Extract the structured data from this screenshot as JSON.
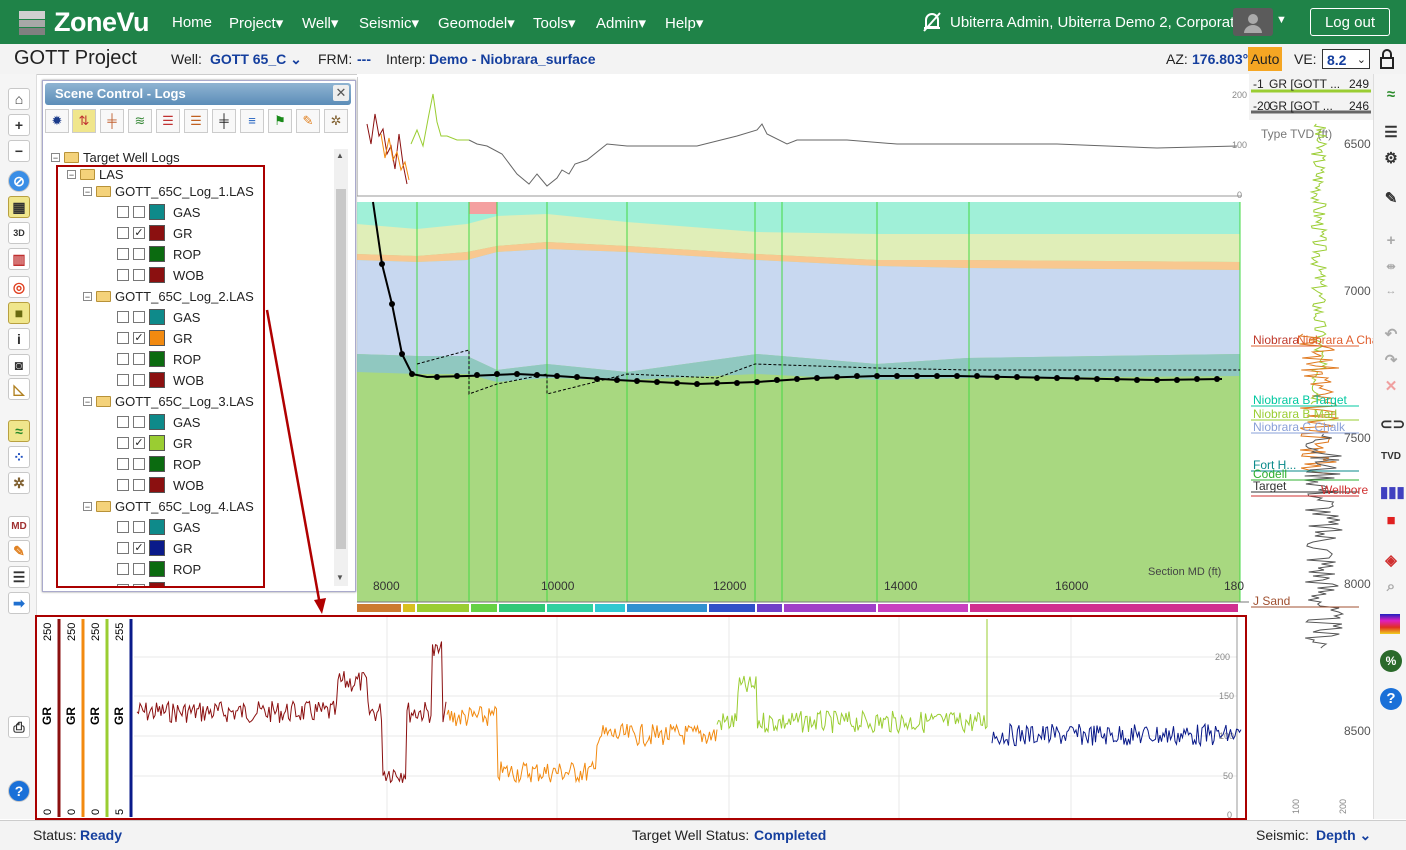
{
  "app": {
    "name": "ZoneVu"
  },
  "nav": {
    "menus": [
      "Home",
      "Project",
      "Well",
      "Seismic",
      "Geomodel",
      "Tools",
      "Admin",
      "Help"
    ],
    "user": "Ubiterra Admin, Ubiterra Demo 2, Corporate",
    "logout": "Log out"
  },
  "project": {
    "title": "GOTT Project",
    "well_label": "Well:",
    "well_value": "GOTT 65_C",
    "frm_label": "FRM:",
    "frm_value": "---",
    "interp_label": "Interp:",
    "interp_value": "Demo - Niobrara_surface",
    "az_label": "AZ:",
    "az_value": "176.803°",
    "auto_label": "Auto",
    "ve_label": "VE:",
    "ve_value": "8.2"
  },
  "scene": {
    "title": "Scene Control - Logs",
    "root": "Target Well Logs",
    "group": "LAS",
    "files": [
      {
        "name": "GOTT_65C_Log_1.LAS",
        "curves": [
          {
            "name": "GAS",
            "color": "#0e8a8a",
            "checked": false
          },
          {
            "name": "GR",
            "color": "#8b1010",
            "checked": true
          },
          {
            "name": "ROP",
            "color": "#0b6b10",
            "checked": false
          },
          {
            "name": "WOB",
            "color": "#8b1010",
            "checked": false
          }
        ]
      },
      {
        "name": "GOTT_65C_Log_2.LAS",
        "curves": [
          {
            "name": "GAS",
            "color": "#0e8a8a",
            "checked": false
          },
          {
            "name": "GR",
            "color": "#f28a10",
            "checked": true
          },
          {
            "name": "ROP",
            "color": "#0b6b10",
            "checked": false
          },
          {
            "name": "WOB",
            "color": "#8b1010",
            "checked": false
          }
        ]
      },
      {
        "name": "GOTT_65C_Log_3.LAS",
        "curves": [
          {
            "name": "GAS",
            "color": "#0e8a8a",
            "checked": false
          },
          {
            "name": "GR",
            "color": "#9acd32",
            "checked": true
          },
          {
            "name": "ROP",
            "color": "#0b6b10",
            "checked": false
          },
          {
            "name": "WOB",
            "color": "#8b1010",
            "checked": false
          }
        ]
      },
      {
        "name": "GOTT_65C_Log_4.LAS",
        "curves": [
          {
            "name": "GAS",
            "color": "#0e8a8a",
            "checked": false
          },
          {
            "name": "GR",
            "color": "#0a1a8a",
            "checked": true
          },
          {
            "name": "ROP",
            "color": "#0b6b10",
            "checked": false
          },
          {
            "name": "WOB",
            "color": "#8b1010",
            "checked": false
          }
        ]
      }
    ]
  },
  "section": {
    "x_ticks": [
      "8000",
      "10000",
      "12000",
      "14000",
      "16000",
      "180"
    ],
    "axis_label": "Section MD (ft)",
    "top_ticks": [
      "200",
      "100",
      "0"
    ]
  },
  "bottom": {
    "tracks": [
      {
        "name": "GR",
        "max": "250",
        "min": "0",
        "color": "#8b1010"
      },
      {
        "name": "GR",
        "max": "250",
        "min": "0",
        "color": "#f28a10"
      },
      {
        "name": "GR",
        "max": "250",
        "min": "0",
        "color": "#9acd32"
      },
      {
        "name": "GR",
        "max": "255",
        "min": "5",
        "color": "#0a1a8a"
      }
    ],
    "y_ticks": [
      "200",
      "150",
      "100",
      "50",
      "0"
    ]
  },
  "typelog": {
    "legend": [
      {
        "range": "-1",
        "name": "GR [GOTT ...",
        "value": "249"
      },
      {
        "range": "-20",
        "name": "GR [GOT ...",
        "value": "246"
      }
    ],
    "axis_label": "Type TVD (ft)",
    "depth_ticks": [
      "6500",
      "7000",
      "7500",
      "8000",
      "8500"
    ],
    "bottom_ticks": [
      "100",
      "200"
    ],
    "formations": [
      {
        "name": "Niobrara",
        "color": "#c0392b"
      },
      {
        "name": "Niobrara A Chalk",
        "color": "#e06030"
      },
      {
        "name": "Niobrara B Target",
        "color": "#00c8a0"
      },
      {
        "name": "Niobrara B Marl",
        "color": "#9acd32"
      },
      {
        "name": "Niobrara C Chalk",
        "color": "#8aa0d8"
      },
      {
        "name": "Fort H...",
        "color": "#0a8a8a"
      },
      {
        "name": "Codell",
        "color": "#30b030"
      },
      {
        "name": "Target",
        "color": "#333333"
      },
      {
        "name": "Wellbore",
        "color": "#d03030"
      },
      {
        "name": "J Sand",
        "color": "#a05030"
      }
    ]
  },
  "status": {
    "status_label": "Status:",
    "status_value": "Ready",
    "target_label": "Target Well Status:",
    "target_value": "Completed",
    "seismic_label": "Seismic:",
    "seismic_value": "Depth"
  }
}
